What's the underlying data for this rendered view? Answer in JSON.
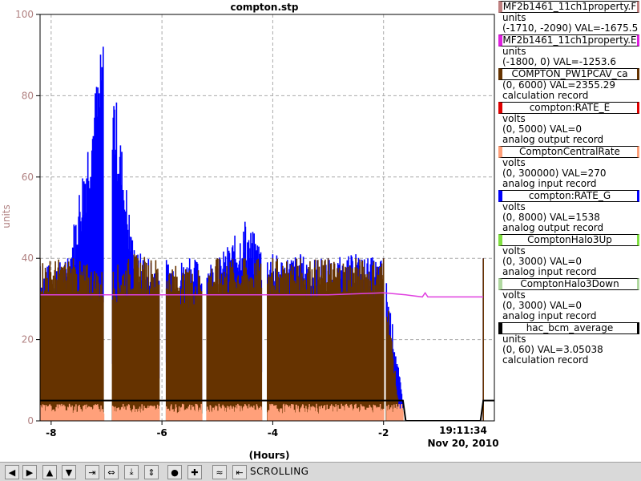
{
  "window": {
    "title": "compton.stp"
  },
  "chart_data": {
    "type": "line",
    "title": "compton.stp",
    "xlabel": "(Hours)",
    "ylabel": "units",
    "xlim": [
      -8.2,
      0
    ],
    "ylim": [
      0,
      100
    ],
    "x_ticks": [
      -8,
      -6,
      -4,
      -2
    ],
    "x_tick_labels": [
      "-8",
      "-6",
      "-4",
      "-2"
    ],
    "y_ticks": [
      0,
      20,
      40,
      60,
      80,
      100
    ],
    "y_tick_labels": [
      "0",
      "20",
      "40",
      "60",
      "80",
      "100"
    ],
    "current_time_label": "19:11:34",
    "current_date_label": "Nov 20, 2010",
    "grid": true,
    "legend_placement": "right",
    "series": [
      {
        "name": "compton:RATE_G",
        "color": "#0000ff",
        "type": "spikes",
        "x": [
          -8.2,
          -7.7,
          -7.0,
          -6.5,
          -6.0,
          -5.5,
          -5.0,
          -4.5,
          -4.0,
          -3.5,
          -3.0,
          -2.5,
          -2.0,
          -1.6,
          -0.2
        ],
        "values": [
          38,
          40,
          100,
          42,
          40,
          40,
          40,
          49,
          41,
          41,
          40,
          41,
          40,
          0,
          40
        ]
      },
      {
        "name": "COMPTON_PW1PCAV_ca",
        "color": "#663300",
        "type": "spikes",
        "x": [
          -8.2,
          -7.6,
          -7.0,
          -6.5,
          -6.0,
          -5.5,
          -5.0,
          -4.5,
          -4.0,
          -3.5,
          -3.0,
          -2.5,
          -2.0,
          -1.7,
          -0.2
        ],
        "values": [
          40,
          40,
          37,
          41,
          40,
          37,
          40,
          40,
          40,
          40,
          40,
          40,
          40,
          0,
          40
        ]
      },
      {
        "name": "MF2b1461_11ch1property.E",
        "color": "#e040e0",
        "type": "line",
        "x": [
          -8.2,
          -7.0,
          -6.0,
          -5.0,
          -4.0,
          -3.0,
          -2.0,
          -1.6,
          -1.3,
          -1.25,
          -1.2,
          -0.2
        ],
        "values": [
          31,
          31,
          31,
          31,
          31,
          31,
          31.5,
          31,
          30.5,
          31.5,
          30.5,
          30.5
        ]
      },
      {
        "name": "hac_bcm_average",
        "color": "#000000",
        "type": "line",
        "x": [
          -8.2,
          -7.0,
          -6.0,
          -5.0,
          -4.0,
          -3.0,
          -2.0,
          -1.65,
          -1.6,
          -0.25,
          -0.2,
          0
        ],
        "values": [
          5,
          5,
          5,
          5,
          5,
          5,
          5,
          5,
          0,
          0,
          5,
          5
        ]
      },
      {
        "name": "ComptonCentralRate",
        "color": "#ffa07a",
        "type": "band",
        "x": [
          -8.2,
          -1.65
        ],
        "values": [
          3,
          3
        ]
      }
    ]
  },
  "legend": [
    {
      "name": "MF2b1461_11ch1property.F",
      "color": "#c08080",
      "unit": "units",
      "range": "(-1710, -2090) VAL=-1675.5",
      "type": ""
    },
    {
      "name": "MF2b1461_11ch1property.E",
      "color": "#e020e0",
      "unit": "units",
      "range": "(-1800, 0) VAL=-1253.6",
      "type": ""
    },
    {
      "name": "COMPTON_PW1PCAV_ca",
      "color": "#663300",
      "unit": "",
      "range": "(0, 6000) VAL=2355.29",
      "type": "calculation record"
    },
    {
      "name": "compton:RATE_E",
      "color": "#e00000",
      "unit": "volts",
      "range": "(0, 5000) VAL=0",
      "type": "analog output record"
    },
    {
      "name": "ComptonCentralRate",
      "color": "#ffa07a",
      "unit": "volts",
      "range": "(0, 300000) VAL=270",
      "type": "analog input record"
    },
    {
      "name": "compton:RATE_G",
      "color": "#0000ff",
      "unit": "volts",
      "range": "(0, 8000) VAL=1538",
      "type": "analog output record"
    },
    {
      "name": "ComptonHalo3Up",
      "color": "#80e040",
      "unit": "volts",
      "range": "(0, 3000) VAL=0",
      "type": "analog input record"
    },
    {
      "name": "ComptonHalo3Down",
      "color": "#b0d8a0",
      "unit": "volts",
      "range": "(0, 3000) VAL=0",
      "type": "analog input record"
    },
    {
      "name": "hac_bcm_average",
      "color": "#000000",
      "unit": "units",
      "range": "(0, 60) VAL=3.05038",
      "type": "calculation record"
    }
  ],
  "toolbar": {
    "status": "SCROLLING",
    "buttons": [
      {
        "name": "pan-left-button",
        "icon": "arrow-left-icon",
        "glyph": "◀"
      },
      {
        "name": "pan-right-button",
        "icon": "arrow-right-icon",
        "glyph": "▶"
      },
      {
        "name": "pan-up-button",
        "icon": "arrow-up-icon",
        "glyph": "▲"
      },
      {
        "name": "pan-down-button",
        "icon": "arrow-down-icon",
        "glyph": "▼"
      },
      {
        "name": "zoom-in-x-button",
        "icon": "zoom-in-x-icon",
        "glyph": "⇥"
      },
      {
        "name": "zoom-out-x-button",
        "icon": "zoom-out-x-icon",
        "glyph": "⇔"
      },
      {
        "name": "zoom-in-y-button",
        "icon": "zoom-in-y-icon",
        "glyph": "⤓"
      },
      {
        "name": "zoom-out-y-button",
        "icon": "zoom-out-y-icon",
        "glyph": "⇕"
      },
      {
        "name": "auto-scale-button",
        "icon": "circle-icon",
        "glyph": "●"
      },
      {
        "name": "reset-button",
        "icon": "plus-icon",
        "glyph": "✚"
      },
      {
        "name": "fit-button",
        "icon": "wave-icon",
        "glyph": "≈"
      },
      {
        "name": "scroll-button",
        "icon": "scroll-icon",
        "glyph": "⇤"
      }
    ]
  }
}
